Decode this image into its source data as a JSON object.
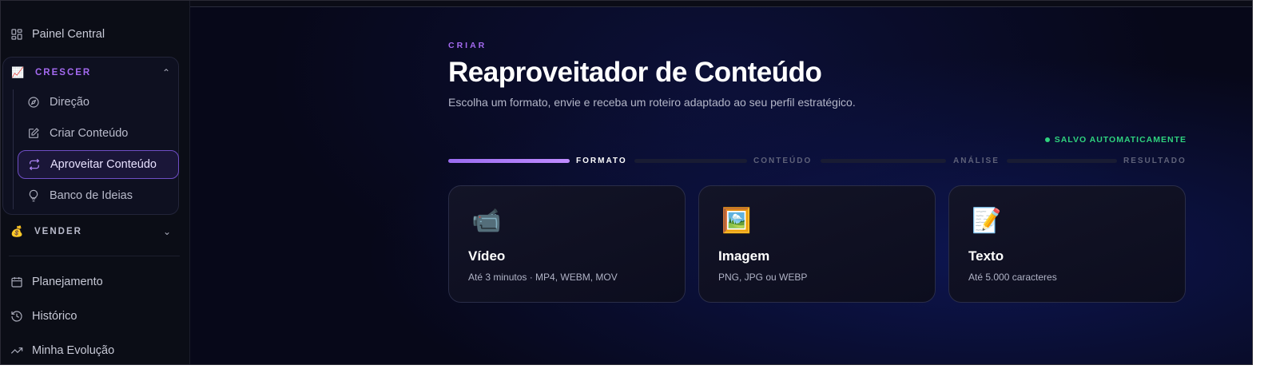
{
  "sidebar": {
    "dashboard_label": "Painel Central",
    "grow_group": {
      "emoji": "📈",
      "label": "CRESCER",
      "items": [
        {
          "label": "Direção",
          "icon": "compass-icon"
        },
        {
          "label": "Criar Conteúdo",
          "icon": "edit-icon"
        },
        {
          "label": "Aproveitar Conteúdo",
          "icon": "repeat-icon",
          "active": true
        },
        {
          "label": "Banco de Ideias",
          "icon": "lightbulb-icon"
        }
      ]
    },
    "sell_group": {
      "emoji": "💰",
      "label": "VENDER"
    },
    "bottom_items": [
      {
        "label": "Planejamento",
        "icon": "calendar-icon"
      },
      {
        "label": "Histórico",
        "icon": "history-icon"
      },
      {
        "label": "Minha Evolução",
        "icon": "trending-up-icon"
      }
    ]
  },
  "main": {
    "eyebrow": "CRIAR",
    "title": "Reaproveitador de Conteúdo",
    "subtitle": "Escolha um formato, envie e receba um roteiro adaptado ao seu perfil estratégico.",
    "autosave": "SALVO AUTOMATICAMENTE",
    "steps": [
      {
        "label": "FORMATO",
        "state": "current"
      },
      {
        "label": "CONTEÚDO",
        "state": "pending"
      },
      {
        "label": "ANÁLISE",
        "state": "pending"
      },
      {
        "label": "RESULTADO",
        "state": "pending"
      }
    ],
    "cards": [
      {
        "emoji": "📹",
        "title": "Vídeo",
        "desc": "Até 3 minutos · MP4, WEBM, MOV"
      },
      {
        "emoji": "🖼️",
        "title": "Imagem",
        "desc": "PNG, JPG ou WEBP"
      },
      {
        "emoji": "📝",
        "title": "Texto",
        "desc": "Até 5.000 caracteres"
      }
    ]
  },
  "colors": {
    "accent": "#a46af0",
    "success": "#2fd27e",
    "background": "#070819"
  }
}
